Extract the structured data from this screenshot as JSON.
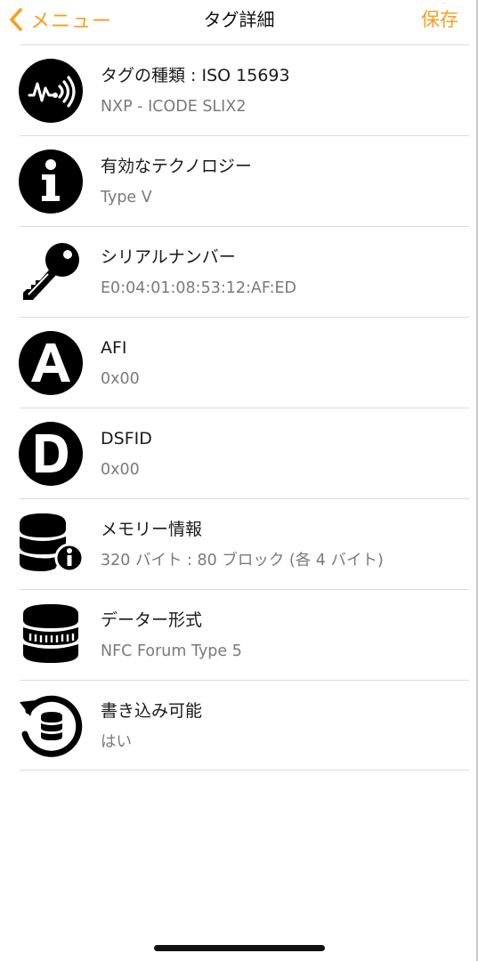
{
  "nav": {
    "back_label": "メニュー",
    "title": "タグ詳細",
    "save_label": "保存"
  },
  "rows": [
    {
      "icon": "nfc-tag-icon",
      "title": "タグの種類 : ISO 15693",
      "value": "NXP - ICODE SLIX2"
    },
    {
      "icon": "info-icon",
      "title": "有効なテクノロジー",
      "value": "Type V"
    },
    {
      "icon": "key-icon",
      "title": "シリアルナンバー",
      "value": "E0:04:01:08:53:12:AF:ED"
    },
    {
      "icon": "letter-a-icon",
      "title": "AFI",
      "value": "0x00"
    },
    {
      "icon": "letter-d-icon",
      "title": "DSFID",
      "value": "0x00"
    },
    {
      "icon": "database-info-icon",
      "title": "メモリー情報",
      "value": "320 バイト : 80 ブロック (各 4 バイト)"
    },
    {
      "icon": "database-format-icon",
      "title": "データー形式",
      "value": "NFC Forum Type 5"
    },
    {
      "icon": "database-refresh-icon",
      "title": "書き込み可能",
      "value": "はい"
    }
  ],
  "colors": {
    "accent": "#f4a020",
    "text": "#1a1a1a",
    "secondary": "#7a7a7a",
    "separator": "#dcdcdc"
  }
}
